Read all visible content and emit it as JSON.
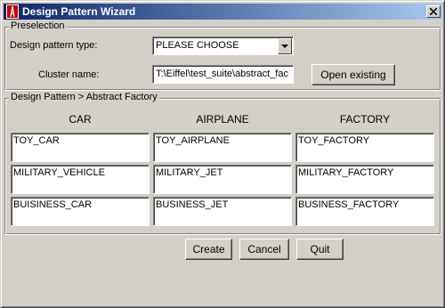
{
  "window": {
    "title": "Design Pattern Wizard",
    "app_icon": "eiffel-tower-icon",
    "close_icon": "close-icon"
  },
  "preselection": {
    "legend": "Preselection",
    "pattern_type_label": "Design pattern type:",
    "pattern_type_value": "PLEASE CHOOSE",
    "cluster_label": "Cluster name:",
    "cluster_value": "T:\\Eiffel\\test_suite\\abstract_fac",
    "open_existing_label": "Open existing"
  },
  "factory_group": {
    "legend": "Design Pattern > Abstract Factory",
    "columns": [
      "CAR",
      "AIRPLANE",
      "FACTORY"
    ],
    "rows": [
      [
        "TOY_CAR",
        "TOY_AIRPLANE",
        "TOY_FACTORY"
      ],
      [
        "MILITARY_VEHICLE",
        "MILITARY_JET",
        "MILITARY_FACTORY"
      ],
      [
        "BUISINESS_CAR",
        "BUSINESS_JET",
        "BUSINESS_FACTORY"
      ]
    ]
  },
  "actions": {
    "create_label": "Create",
    "cancel_label": "Cancel",
    "quit_label": "Quit"
  },
  "colors": {
    "face": "#d4d0c8",
    "titlebar_start": "#0a246a",
    "titlebar_end": "#a6caf0"
  }
}
